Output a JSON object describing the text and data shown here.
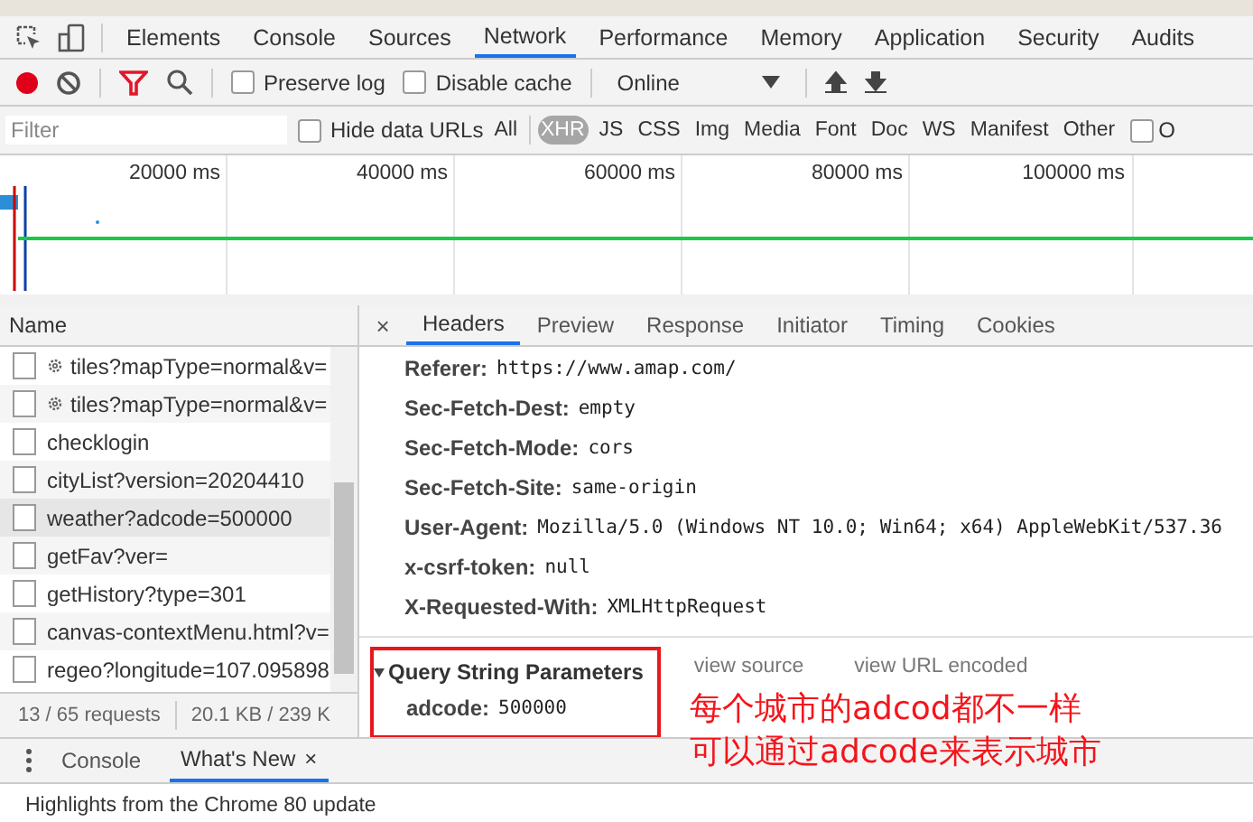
{
  "main_tabs": [
    {
      "label": "Elements",
      "selected": false
    },
    {
      "label": "Console",
      "selected": false
    },
    {
      "label": "Sources",
      "selected": false
    },
    {
      "label": "Network",
      "selected": true
    },
    {
      "label": "Performance",
      "selected": false
    },
    {
      "label": "Memory",
      "selected": false
    },
    {
      "label": "Application",
      "selected": false
    },
    {
      "label": "Security",
      "selected": false
    },
    {
      "label": "Audits",
      "selected": false
    }
  ],
  "toolbar": {
    "recording": true,
    "preserve_log": {
      "label": "Preserve log",
      "checked": false
    },
    "disable_cache": {
      "label": "Disable cache",
      "checked": false
    },
    "throttling": "Online"
  },
  "filter_bar": {
    "placeholder": "Filter",
    "hide_data_urls": {
      "label": "Hide data URLs",
      "checked": false
    },
    "types": [
      {
        "label": "All",
        "selected": false
      },
      {
        "label": "XHR",
        "selected": true
      },
      {
        "label": "JS",
        "selected": false
      },
      {
        "label": "CSS",
        "selected": false
      },
      {
        "label": "Img",
        "selected": false
      },
      {
        "label": "Media",
        "selected": false
      },
      {
        "label": "Font",
        "selected": false
      },
      {
        "label": "Doc",
        "selected": false
      },
      {
        "label": "WS",
        "selected": false
      },
      {
        "label": "Manifest",
        "selected": false
      },
      {
        "label": "Other",
        "selected": false
      }
    ],
    "other_checkbox": {
      "label": "O",
      "checked": false
    }
  },
  "timeline": {
    "ticks": [
      "20000 ms",
      "40000 ms",
      "60000 ms",
      "80000 ms",
      "100000 ms"
    ]
  },
  "request_list": {
    "header": "Name",
    "rows": [
      {
        "name": "tiles?mapType=normal&v=",
        "gear": true,
        "selected": false
      },
      {
        "name": "tiles?mapType=normal&v=",
        "gear": true,
        "selected": false
      },
      {
        "name": "checklogin",
        "gear": false,
        "selected": false
      },
      {
        "name": "cityList?version=20204410",
        "gear": false,
        "selected": false
      },
      {
        "name": "weather?adcode=500000",
        "gear": false,
        "selected": true
      },
      {
        "name": "getFav?ver=",
        "gear": false,
        "selected": false
      },
      {
        "name": "getHistory?type=301",
        "gear": false,
        "selected": false
      },
      {
        "name": "canvas-contextMenu.html?v=",
        "gear": false,
        "selected": false
      },
      {
        "name": "regeo?longitude=107.095898",
        "gear": false,
        "selected": false
      }
    ],
    "summary": [
      "13 / 65 requests",
      "20.1 KB / 239 K"
    ]
  },
  "detail": {
    "close": "×",
    "tabs": [
      {
        "label": "Headers",
        "selected": true
      },
      {
        "label": "Preview",
        "selected": false
      },
      {
        "label": "Response",
        "selected": false
      },
      {
        "label": "Initiator",
        "selected": false
      },
      {
        "label": "Timing",
        "selected": false
      },
      {
        "label": "Cookies",
        "selected": false
      }
    ],
    "headers": [
      {
        "name": "Referer:",
        "value": "https://www.amap.com/"
      },
      {
        "name": "Sec-Fetch-Dest:",
        "value": "empty"
      },
      {
        "name": "Sec-Fetch-Mode:",
        "value": "cors"
      },
      {
        "name": "Sec-Fetch-Site:",
        "value": "same-origin"
      },
      {
        "name": "User-Agent:",
        "value": "Mozilla/5.0 (Windows NT 10.0; Win64; x64) AppleWebKit/537.36"
      },
      {
        "name": "x-csrf-token:",
        "value": "null"
      },
      {
        "name": "X-Requested-With:",
        "value": "XMLHttpRequest"
      }
    ],
    "query": {
      "title": "Query String Parameters",
      "expanded": true,
      "links": [
        "view source",
        "view URL encoded"
      ],
      "params": [
        {
          "name": "adcode:",
          "value": "500000"
        }
      ]
    },
    "annotation": [
      "每个城市的adcod都不一样",
      "可以通过adcode来表示城市"
    ]
  },
  "drawer": {
    "tabs": [
      {
        "label": "Console",
        "selected": false,
        "closable": false
      },
      {
        "label": "What's New",
        "selected": true,
        "closable": true
      }
    ],
    "close": "×",
    "text": "Highlights from the Chrome 80 update"
  }
}
